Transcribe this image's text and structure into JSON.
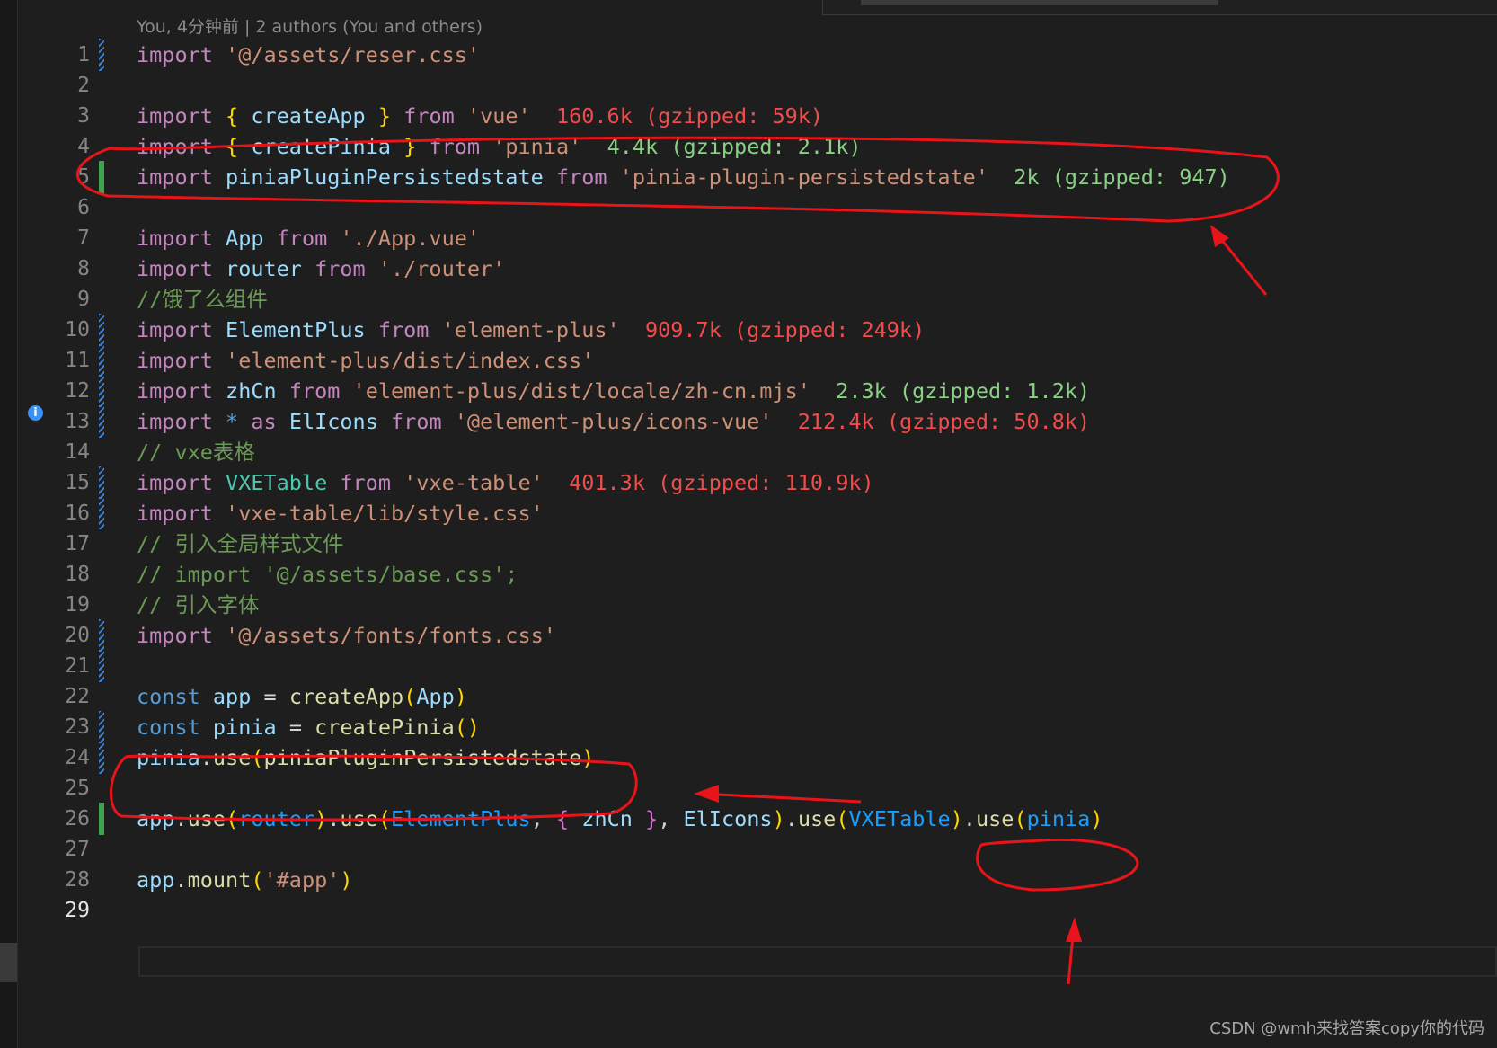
{
  "blame_text": "You, 4分钟前 | 2 authors (You and others)",
  "watermark": "CSDN @wmh来找答案copy你的代码",
  "colors": {
    "background": "#1e1e1e",
    "annotation": "#e8141a",
    "gutter_modified": "#3b82d6",
    "gutter_added": "#3fa34d"
  },
  "lines": {
    "l1": [
      "1",
      "import",
      "'@/assets/reser.css'"
    ],
    "l2": [
      "2"
    ],
    "l3": [
      "3",
      "import",
      "{",
      "createApp",
      "}",
      "from",
      "'vue'",
      "160.6k (gzipped: 59k)"
    ],
    "l4": [
      "4",
      "import",
      "{",
      "createPinia",
      "}",
      "from",
      "'pinia'",
      "4.4k (gzipped: 2.1k)"
    ],
    "l5": [
      "5",
      "import",
      "piniaPluginPersistedstate",
      "from",
      "'pinia-plugin-persistedstate'",
      "2k (gzipped: 947)"
    ],
    "l6": [
      "6"
    ],
    "l7": [
      "7",
      "import",
      "App",
      "from",
      "'./App.vue'"
    ],
    "l8": [
      "8",
      "import",
      "router",
      "from",
      "'./router'"
    ],
    "l9": [
      "9",
      "//饿了么组件"
    ],
    "l10": [
      "10",
      "import",
      "ElementPlus",
      "from",
      "'element-plus'",
      "909.7k (gzipped: 249k)"
    ],
    "l11": [
      "11",
      "import",
      "'element-plus/dist/index.css'"
    ],
    "l12": [
      "12",
      "import",
      "zhCn",
      "from",
      "'element-plus/dist/locale/zh-cn.mjs'",
      "2.3k (gzipped: 1.2k)"
    ],
    "l13": [
      "13",
      "import",
      "*",
      "as",
      "ElIcons",
      "from",
      "'@element-plus/icons-vue'",
      "212.4k (gzipped: 50.8k)"
    ],
    "l14": [
      "14",
      "// vxe表格"
    ],
    "l15": [
      "15",
      "import",
      "VXETable",
      "from",
      "'vxe-table'",
      "401.3k (gzipped: 110.9k)"
    ],
    "l16": [
      "16",
      "import",
      "'vxe-table/lib/style.css'"
    ],
    "l17": [
      "17",
      "// 引入全局样式文件"
    ],
    "l18": [
      "18",
      "// import '@/assets/base.css';"
    ],
    "l19": [
      "19",
      "// 引入字体"
    ],
    "l20": [
      "20",
      "import",
      "'@/assets/fonts/fonts.css'"
    ],
    "l21": [
      "21"
    ],
    "l22": [
      "22",
      "const",
      "app",
      "=",
      "createApp",
      "(",
      "App",
      ")"
    ],
    "l23": [
      "23",
      "const",
      "pinia",
      "=",
      "createPinia",
      "()"
    ],
    "l24": [
      "24",
      "pinia",
      ".",
      "use",
      "(",
      "piniaPluginPersistedstate",
      ")"
    ],
    "l25": [
      "25"
    ],
    "l26": [
      "26",
      "app",
      ".",
      "use",
      "(",
      "router",
      ")",
      ".",
      "use",
      "(",
      "ElementPlus",
      ",",
      "{",
      "zhCn",
      "}",
      ",",
      "ElIcons",
      ")",
      ".",
      "use",
      "(",
      "VXETable",
      ")",
      ".",
      "use",
      "(",
      "pinia",
      ")"
    ],
    "l27": [
      "27"
    ],
    "l28": [
      "28",
      "app",
      ".",
      "mount",
      "(",
      "'#app'",
      ")"
    ],
    "l29": [
      "29"
    ]
  }
}
